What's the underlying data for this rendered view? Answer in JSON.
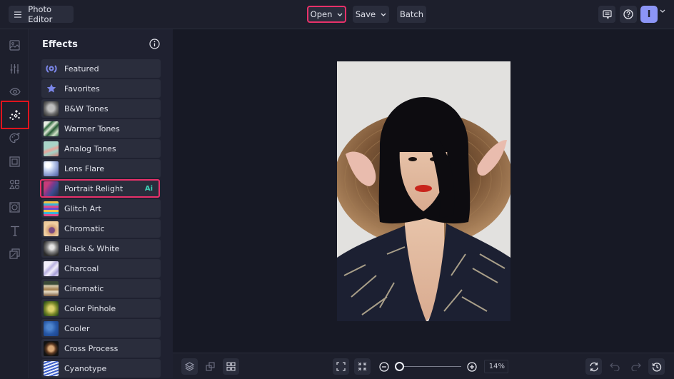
{
  "header": {
    "app_title": "Photo Editor",
    "open_label": "Open",
    "save_label": "Save",
    "batch_label": "Batch",
    "avatar_initial": "I"
  },
  "rail": {
    "items": [
      {
        "name": "image-icon",
        "label": "Edit"
      },
      {
        "name": "sliders-icon",
        "label": "Adjust"
      },
      {
        "name": "eye-icon",
        "label": "Touch Up"
      },
      {
        "name": "sparkles-icon",
        "label": "Effects",
        "active": true
      },
      {
        "name": "palette-icon",
        "label": "Artsy"
      },
      {
        "name": "frame-icon",
        "label": "Frames"
      },
      {
        "name": "shapes-icon",
        "label": "Graphics"
      },
      {
        "name": "texture-icon",
        "label": "Overlays"
      },
      {
        "name": "text-icon",
        "label": "Text"
      },
      {
        "name": "layers-copy-icon",
        "label": "Cutout"
      }
    ]
  },
  "panel": {
    "title": "Effects",
    "items": [
      {
        "label": "Featured",
        "thumb": "icon-featured"
      },
      {
        "label": "Favorites",
        "thumb": "icon-star"
      },
      {
        "label": "B&W Tones",
        "thumb": "bw"
      },
      {
        "label": "Warmer Tones",
        "thumb": "warm"
      },
      {
        "label": "Analog Tones",
        "thumb": "analog"
      },
      {
        "label": "Lens Flare",
        "thumb": "flare"
      },
      {
        "label": "Portrait Relight",
        "thumb": "relight",
        "badge": "Ai",
        "selected": true
      },
      {
        "label": "Glitch Art",
        "thumb": "glitch"
      },
      {
        "label": "Chromatic",
        "thumb": "chromatic"
      },
      {
        "label": "Black & White",
        "thumb": "blackwhite"
      },
      {
        "label": "Charcoal",
        "thumb": "charcoal"
      },
      {
        "label": "Cinematic",
        "thumb": "cinematic"
      },
      {
        "label": "Color Pinhole",
        "thumb": "pinhole"
      },
      {
        "label": "Cooler",
        "thumb": "cooler"
      },
      {
        "label": "Cross Process",
        "thumb": "cross"
      },
      {
        "label": "Cyanotype",
        "thumb": "cyanotype"
      }
    ]
  },
  "footer": {
    "zoom_value": "14%",
    "zoom_fraction": 0.0
  },
  "colors": {
    "accent_pink": "#e8316a",
    "active_red": "#e0141d",
    "avatar_bg": "#8c95f6",
    "ai_badge": "#3fd1b6"
  }
}
